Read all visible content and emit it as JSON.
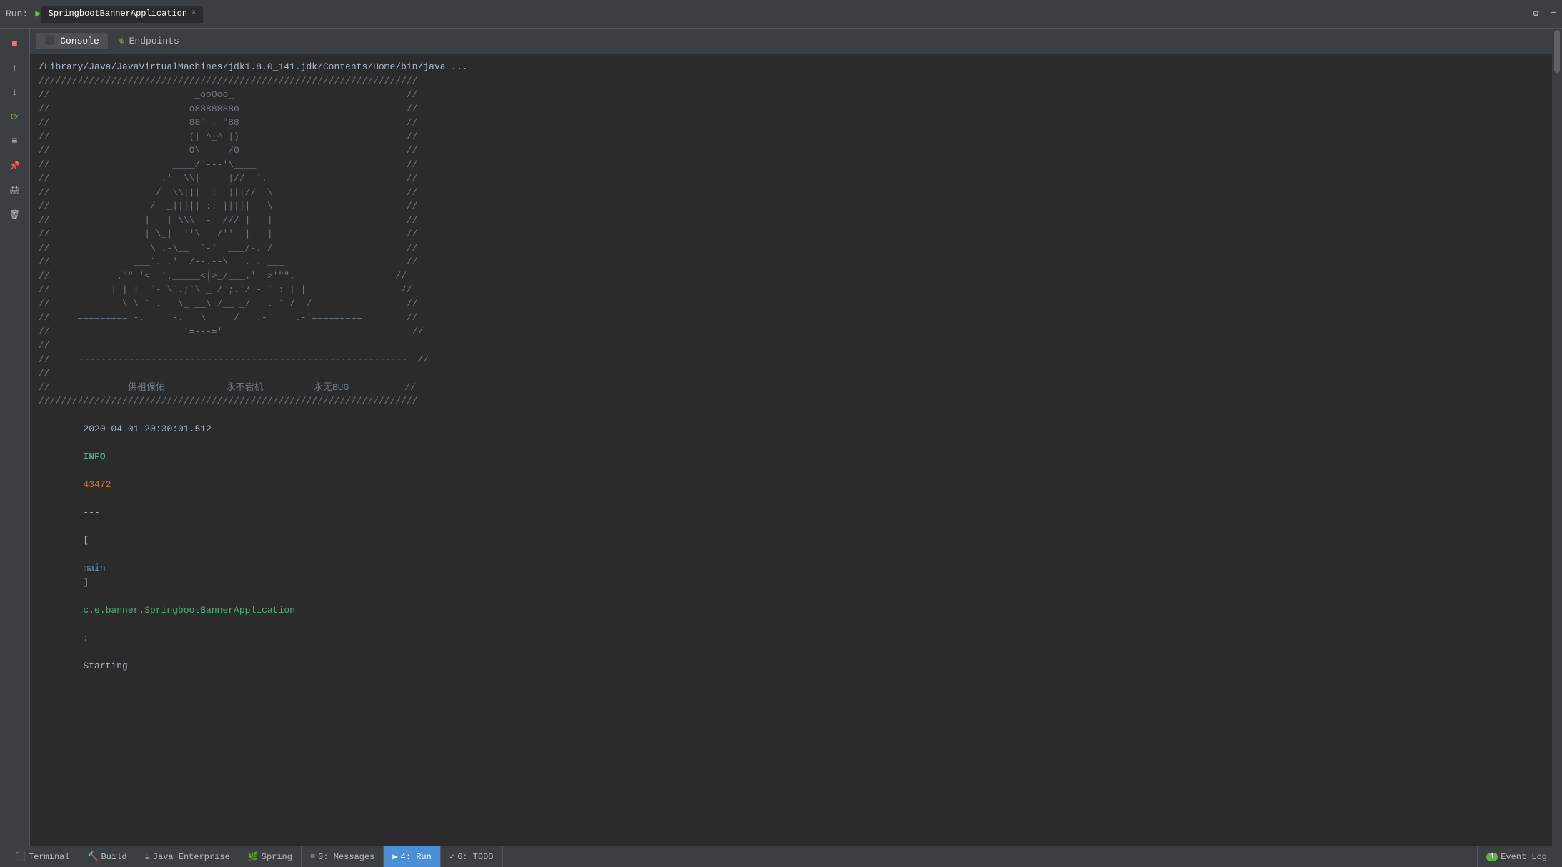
{
  "titlebar": {
    "run_label": "Run:",
    "app_name": "SpringbootBannerApplication",
    "close_icon": "×",
    "settings_icon": "⚙",
    "minimize_icon": "−"
  },
  "tabs": {
    "console": "Console",
    "endpoints": "Endpoints"
  },
  "toolbar_buttons": [
    {
      "name": "stop",
      "icon": "■",
      "class": "red"
    },
    {
      "name": "scroll-up",
      "icon": "↑",
      "class": ""
    },
    {
      "name": "scroll-down",
      "icon": "↓",
      "class": ""
    },
    {
      "name": "rerun",
      "icon": "↺",
      "class": "green"
    },
    {
      "name": "wrap",
      "icon": "≡",
      "class": ""
    },
    {
      "name": "pin",
      "icon": "📌",
      "class": "pinned"
    },
    {
      "name": "print",
      "icon": "🖨",
      "class": ""
    },
    {
      "name": "clear",
      "icon": "🗑",
      "class": ""
    }
  ],
  "console": {
    "path_line": "/Library/Java/JavaVirtualMachines/jdk1.8.0_141.jdk/Contents/Home/bin/java ...",
    "ascii_art": [
      "////////////////////////////////////////////////////////////////////",
      "//                          _ooOoo_                               //",
      "//                         o8888888o                              //",
      "//                         88\" . \"88                             //",
      "//                         (| ^_^ |)                              //",
      "//                         O\\  =  /O                             //",
      "//                      ____/`---'\\____                          //",
      "//                    .'  \\\\|     |//  `.                        //",
      "//                   /  \\\\|||  :  |||//  \\                       //",
      "//                  /  _|||||-::-|||||-  \\                        //",
      "//                 |   | \\\\\\  -  /// |   |                        //",
      "//                 | \\_|  ''\\---/''  |   |                        //",
      "//                  \\ .-\\__  `-`  ___/-. /                        //",
      "//               ___`. .'  /--.--\\  `. . ___                      //",
      "//            .\"\" '<  `.___\\_<|>_/___.'  >'\"\".                    //",
      "//           | | :  `- \\`.;`\\ _ /`;.`/ - ` : | |                 //",
      "//             \\ \\ `-.   \\_ __\\ /__ _/   .-` /  /                 //",
      "//     =========`-.____`-.___\\_____/___.-`____.-'=========        //",
      "//                        `=---='                                  //",
      "//",
      "//     ~~~~~~~~~~~~~~~~~~~~~~~~~~~~~~~~~~~~~~~~~~~~~~~~~~~~~~~~~~~  //",
      "//",
      "//              佛祖保佑           永不宕机         永无BUG          //",
      "////////////////////////////////////////////////////////////////////"
    ],
    "log_line": {
      "timestamp": "2020-04-01 20:30:01.512",
      "level": "INFO",
      "pid": "43472",
      "separator": "---",
      "bracket_open": "[",
      "thread": "main",
      "bracket_close": "]",
      "class": "c.e.banner.SpringbootBannerApplication",
      "colon": ":",
      "message": "Starting"
    }
  },
  "status_bar": {
    "terminal": "Terminal",
    "build": "Build",
    "java_enterprise": "Java Enterprise",
    "spring": "Spring",
    "messages": "0: Messages",
    "run": "4: Run",
    "todo": "6: TODO",
    "event_log_badge": "1",
    "event_log": "Event Log"
  },
  "colors": {
    "bg": "#2b2b2b",
    "toolbar_bg": "#3c3f41",
    "text": "#a9b7c6",
    "green": "#76b947",
    "blue": "#4a90d9",
    "red": "#ff6b68",
    "info_green": "#4caf7d",
    "orange": "#cc7832"
  }
}
